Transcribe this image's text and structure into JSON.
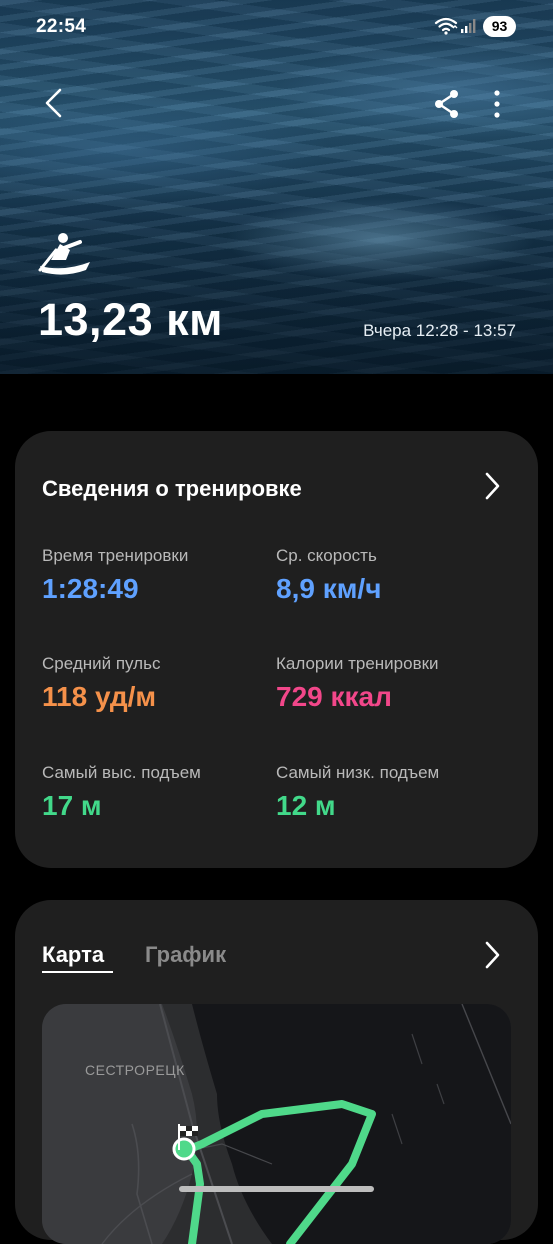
{
  "status_bar": {
    "time": "22:54",
    "battery": "93"
  },
  "header": {
    "distance": "13,23 км",
    "date_range": "Вчера 12:28 - 13:57",
    "icons": {
      "back": "chevron-left-icon",
      "share": "share-icon",
      "more": "more-vertical-icon",
      "activity": "rowing-icon"
    }
  },
  "details": {
    "title": "Сведения о тренировке",
    "stats": [
      {
        "label": "Время тренировки",
        "value": "1:28:49",
        "color": "#5fa1ff"
      },
      {
        "label": "Ср. скорость",
        "value": "8,9 км/ч",
        "color": "#5fa1ff"
      },
      {
        "label": "Средний пульс",
        "value": "118 уд/м",
        "color": "#f5914a"
      },
      {
        "label": "Калории тренировки",
        "value": "729 ккал",
        "color": "#f2478a"
      },
      {
        "label": "Самый выс. подъем",
        "value": "17 м",
        "color": "#42d98a"
      },
      {
        "label": "Самый низк. подъем",
        "value": "12 м",
        "color": "#42d98a"
      }
    ]
  },
  "map_section": {
    "tabs": [
      {
        "label": "Карта",
        "active": true
      },
      {
        "label": "График",
        "active": false
      }
    ],
    "city": "СЕСТРОРЕЦК",
    "route_color": "#4fd98a"
  }
}
